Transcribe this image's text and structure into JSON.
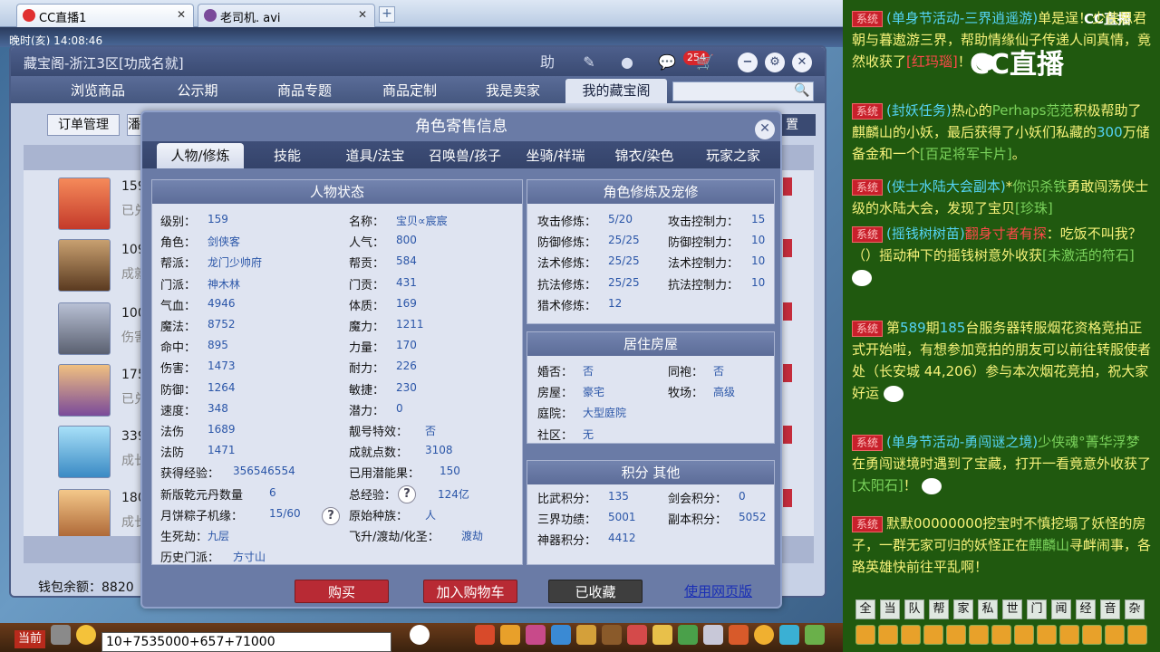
{
  "browser": {
    "tabs": [
      {
        "label": "CC直播1",
        "active": true
      },
      {
        "label": "老司机. avi",
        "active": false
      }
    ]
  },
  "game": {
    "clock": "晚时(亥)    14:08:46"
  },
  "shop": {
    "title": "藏宝阁-浙江3区[功成名就]",
    "help_label": "助",
    "cart_count": "254",
    "tabs": [
      "浏览商品",
      "公示期",
      "商品专题",
      "商品定制",
      "我是卖家",
      "我的藏宝阁"
    ],
    "active_tab": "我的藏宝阁",
    "search_placeholder": "",
    "order_button": "订单管理",
    "order_button2": "潘",
    "settings_right": "置",
    "list_peek": [
      "159",
      "已兑",
      "109",
      "成就",
      "100",
      "伤害",
      "175",
      "已兑",
      "339",
      "成长",
      "180",
      "成长"
    ],
    "wallet_label": "钱包余额：8820"
  },
  "dialog": {
    "title": "角色寄售信息",
    "tabs": [
      "人物/修炼",
      "技能",
      "道具/法宝",
      "召唤兽/孩子",
      "坐骑/祥瑞",
      "锦衣/染色",
      "玩家之家"
    ],
    "active_tab": "人物/修炼",
    "status_head": "人物状态",
    "status_left": [
      {
        "label": "级别：",
        "value": "159"
      },
      {
        "label": "角色：",
        "value": "剑侠客"
      },
      {
        "label": "帮派：",
        "value": "龙门少帅府"
      },
      {
        "label": "门派：",
        "value": "神木林"
      },
      {
        "label": "气血：",
        "value": "4946"
      },
      {
        "label": "魔法：",
        "value": "8752"
      },
      {
        "label": "命中：",
        "value": "895"
      },
      {
        "label": "伤害：",
        "value": "1473"
      },
      {
        "label": "防御：",
        "value": "1264"
      },
      {
        "label": "速度：",
        "value": "348"
      },
      {
        "label": "法伤",
        "value": "1689"
      },
      {
        "label": "法防",
        "value": "1471"
      },
      {
        "label": "获得经验：",
        "value": "356546554"
      },
      {
        "label": "新版乾元丹数量",
        "value": "6"
      },
      {
        "label": "月饼粽子机缘：",
        "value": "15/60"
      },
      {
        "label": "生死劫：",
        "value": "九层"
      },
      {
        "label": "历史门派：",
        "value": "方寸山"
      }
    ],
    "status_right": [
      {
        "label": "名称：",
        "value": "宝贝∝宸宸"
      },
      {
        "label": "人气：",
        "value": "800"
      },
      {
        "label": "帮贡：",
        "value": "584"
      },
      {
        "label": "门贡：",
        "value": "431"
      },
      {
        "label": "体质：",
        "value": "169"
      },
      {
        "label": "魔力：",
        "value": "1211"
      },
      {
        "label": "力量：",
        "value": "170"
      },
      {
        "label": "耐力：",
        "value": "226"
      },
      {
        "label": "敏捷：",
        "value": "230"
      },
      {
        "label": "潜力：",
        "value": "0"
      },
      {
        "label": "靓号特效：",
        "value": "否"
      },
      {
        "label": "成就点数：",
        "value": "3108"
      },
      {
        "label": "已用潜能果：",
        "value": "150"
      },
      {
        "label": "总经验：",
        "value": "124亿"
      },
      {
        "label": "原始种族：",
        "value": "人"
      },
      {
        "label": "飞升/渡劫/化圣：",
        "value": "渡劫"
      }
    ],
    "cultivation_head": "角色修炼及宠修",
    "cultivation_left": [
      {
        "label": "攻击修炼：",
        "value": "5/20"
      },
      {
        "label": "防御修炼：",
        "value": "25/25"
      },
      {
        "label": "法术修炼：",
        "value": "25/25"
      },
      {
        "label": "抗法修炼：",
        "value": "25/25"
      },
      {
        "label": "猎术修炼：",
        "value": "12"
      }
    ],
    "cultivation_right": [
      {
        "label": "攻击控制力：",
        "value": "15"
      },
      {
        "label": "防御控制力：",
        "value": "10"
      },
      {
        "label": "法术控制力：",
        "value": "10"
      },
      {
        "label": "抗法控制力：",
        "value": "10"
      }
    ],
    "house_head": "居住房屋",
    "house_left": [
      {
        "label": "婚否：",
        "value": "否"
      },
      {
        "label": "房屋：",
        "value": "豪宅"
      },
      {
        "label": "庭院：",
        "value": "大型庭院"
      },
      {
        "label": "社区：",
        "value": "无"
      }
    ],
    "house_right": [
      {
        "label": "同袍：",
        "value": "否"
      },
      {
        "label": "牧场：",
        "value": "高级"
      }
    ],
    "points_head": "积分 其他",
    "points_left": [
      {
        "label": "比武积分：",
        "value": "135"
      },
      {
        "label": "三界功绩：",
        "value": "5001"
      },
      {
        "label": "神器积分：",
        "value": "4412"
      }
    ],
    "points_right": [
      {
        "label": "剑会积分：",
        "value": "0"
      },
      {
        "label": "副本积分：",
        "value": "5052"
      }
    ],
    "buy_button": "购买",
    "add_cart_button": "加入购物车",
    "collected_button": "已收藏",
    "web_link": "使用网页版"
  },
  "bottom": {
    "current_label": "当前",
    "chat_value": "10+7535000+657+71000"
  },
  "cc": {
    "logo": "CC直播",
    "logo_small": "CC直播",
    "sys_tag": "系统",
    "messages": [
      {
        "parts": [
          "(单身节活动-三界逍遥游)",
          "单",
          "是",
          "逞！少侠思君朝与暮",
          "遨游三界，帮助情缘仙子传递人间真情，竟",
          "然收获了",
          "[红玛瑙]",
          "！"
        ]
      },
      {
        "parts": [
          "(封妖任务)",
          "热心的",
          "Perhaps范范",
          "积极帮助了麒麟山的小妖，最后获得了小妖们私藏的",
          "300",
          "万储备金和一个",
          "[百足将军卡片]",
          "。"
        ]
      },
      {
        "parts": [
          "(侠士水陆大会副本)",
          "*",
          "你识杀铁",
          "勇敢闯荡侠士级的水陆大会，发现了宝贝",
          "[珍珠]"
        ]
      },
      {
        "parts": [
          "(摇钱树树苗)",
          "翻身寸者有探",
          "：",
          "吃饭不叫我？（",
          "）摇动种下的摇钱树意外收获",
          "[未激活的符石]"
        ]
      },
      {
        "parts": [
          "第",
          "589",
          "期",
          "185",
          "台服务器转服烟花资格竞拍正式开始啦",
          "，有想参加竞拍的朋友可以前往转服使者处（长安城 44,206）参与本次烟花竞拍，祝大家好运"
        ]
      },
      {
        "parts": [
          "(单身节活动-勇闯谜之境)",
          "少侠魂°菁华浮梦",
          "在勇闯谜境时遇到了宝藏，打开一看竟意外收获了",
          "[太阳石]",
          "！"
        ]
      },
      {
        "parts": [
          "默默00000000",
          "挖宝时不慎挖塌了妖怪的房子，一群无家可归的妖怪正在",
          "麒麟山",
          "寻衅闹事，各路英雄快前往平乱啊！"
        ]
      }
    ],
    "toolbar": [
      "全",
      "当",
      "队",
      "帮",
      "家",
      "私",
      "世",
      "门",
      "闻",
      "经",
      "音",
      "杂"
    ]
  }
}
